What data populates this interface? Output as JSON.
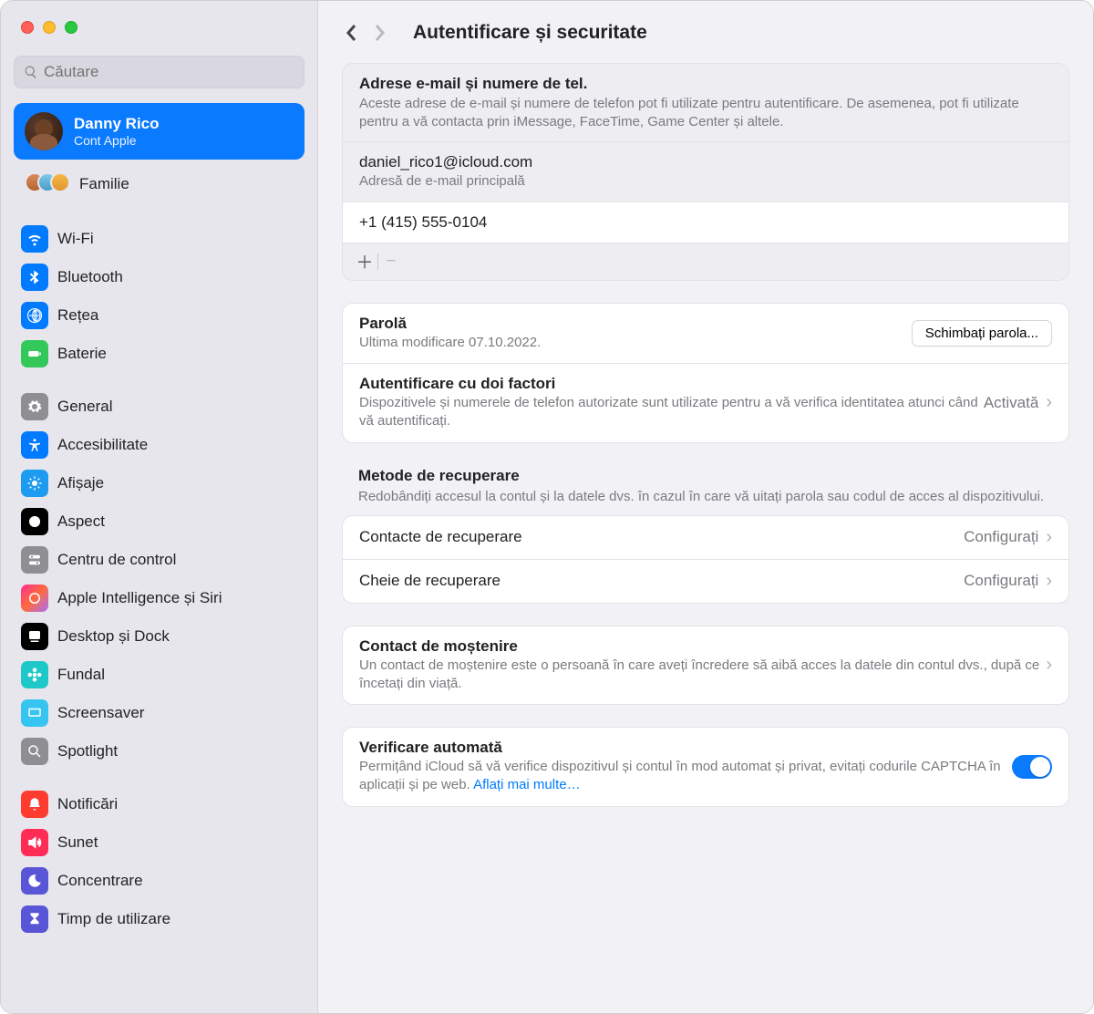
{
  "search": {
    "placeholder": "Căutare"
  },
  "account": {
    "name": "Danny Rico",
    "sub": "Cont Apple"
  },
  "family": {
    "label": "Familie"
  },
  "sidebar": {
    "group1": [
      {
        "label": "Wi-Fi"
      },
      {
        "label": "Bluetooth"
      },
      {
        "label": "Rețea"
      },
      {
        "label": "Baterie"
      }
    ],
    "group2": [
      {
        "label": "General"
      },
      {
        "label": "Accesibilitate"
      },
      {
        "label": "Afișaje"
      },
      {
        "label": "Aspect"
      },
      {
        "label": "Centru de control"
      },
      {
        "label": "Apple Intelligence și Siri"
      },
      {
        "label": "Desktop și Dock"
      },
      {
        "label": "Fundal"
      },
      {
        "label": "Screensaver"
      },
      {
        "label": "Spotlight"
      }
    ],
    "group3": [
      {
        "label": "Notificări"
      },
      {
        "label": "Sunet"
      },
      {
        "label": "Concentrare"
      },
      {
        "label": "Timp de utilizare"
      }
    ]
  },
  "page": {
    "title": "Autentificare și securitate"
  },
  "emails": {
    "title": "Adrese e-mail și numere de tel.",
    "desc": "Aceste adrese de e-mail și numere de telefon pot fi utilizate pentru autentificare. De asemenea, pot fi utilizate pentru a vă contacta prin iMessage, FaceTime, Game Center și altele.",
    "primary_email": "daniel_rico1@icloud.com",
    "primary_email_sub": "Adresă de e-mail principală",
    "phone": "+1 (415) 555-0104"
  },
  "password": {
    "title": "Parolă",
    "sub": "Ultima modificare 07.10.2022.",
    "button": "Schimbați parola..."
  },
  "twofa": {
    "title": "Autentificare cu doi factori",
    "desc": "Dispozitivele și numerele de telefon autorizate sunt utilizate pentru a vă verifica identitatea atunci când vă autentificați.",
    "status": "Activată"
  },
  "recovery": {
    "header": "Metode de recuperare",
    "desc": "Redobândiți accesul la contul și la datele dvs. în cazul în care vă uitați parola sau codul de acces al dispozitivului.",
    "contacts_label": "Contacte de recuperare",
    "contacts_value": "Configurați",
    "key_label": "Cheie de recuperare",
    "key_value": "Configurați"
  },
  "legacy": {
    "title": "Contact de moștenire",
    "desc": "Un contact de moștenire este o persoană în care aveți încredere să aibă acces la datele din contul dvs., după ce încetați din viață."
  },
  "autoverify": {
    "title": "Verificare automată",
    "desc": "Permițând iCloud să vă verifice dispozitivul și contul în mod automat și privat, evitați codurile CAPTCHA în aplicații și pe web. ",
    "link": "Aflați mai multe…"
  }
}
